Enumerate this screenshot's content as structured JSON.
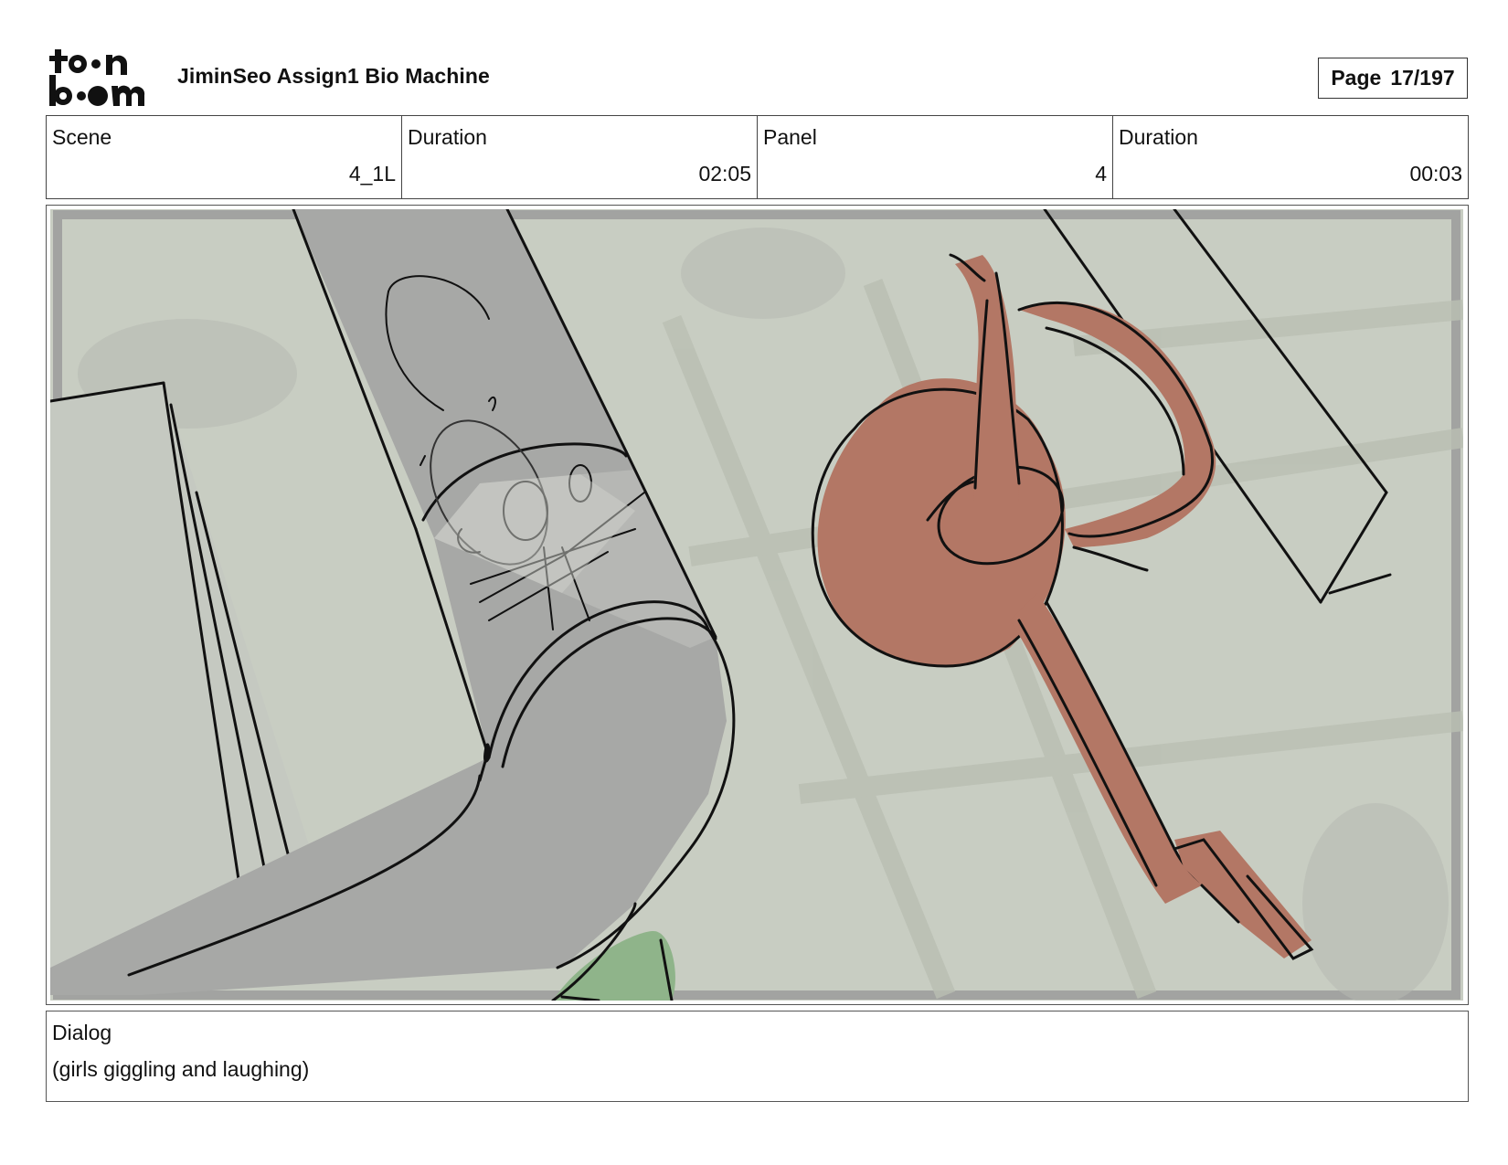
{
  "header": {
    "logo_text": "toon boom",
    "document_title": "JiminSeo Assign1 Bio Machine",
    "page_label": "Page",
    "page_number": "17/197"
  },
  "info": {
    "scene_label": "Scene",
    "scene_value": "4_1L",
    "scene_duration_label": "Duration",
    "scene_duration_value": "02:05",
    "panel_label": "Panel",
    "panel_value": "4",
    "panel_duration_label": "Duration",
    "panel_duration_value": "00:03"
  },
  "dialog": {
    "label": "Dialog",
    "text": "(girls giggling and laughing)"
  },
  "colors": {
    "background_green": "#c8cdc2",
    "shadow_gray": "#a9aaa8",
    "character_red": "#b37765",
    "bush_green": "#8fb48a",
    "ink": "#111111"
  }
}
